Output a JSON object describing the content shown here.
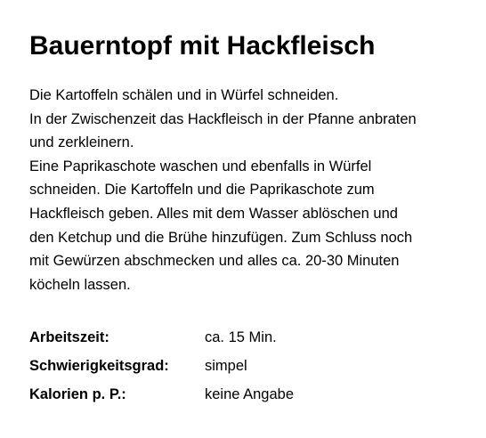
{
  "recipe": {
    "title": "Bauerntopf mit Hackfleisch",
    "instructions": [
      "Die Kartoffeln schälen und in Würfel schneiden.",
      "In der Zwischenzeit das Hackfleisch in der Pfanne anbraten",
      "und zerkleinern.",
      "Eine Paprikaschote waschen und ebenfalls in Würfel",
      "schneiden. Die Kartoffeln und die Paprikaschote zum",
      "Hackfleisch geben. Alles mit dem Wasser ablöschen und",
      "den Ketchup und die Brühe hinzufügen. Zum Schluss noch",
      "mit Gewürzen abschmecken und alles ca. 20-30 Minuten",
      "köcheln lassen."
    ],
    "details": [
      {
        "label": "Arbeitszeit:",
        "value": "ca. 15 Min."
      },
      {
        "label": "Schwierigkeitsgrad:",
        "value": "simpel"
      },
      {
        "label": "Kalorien p. P.:",
        "value": "keine Angabe"
      }
    ]
  }
}
